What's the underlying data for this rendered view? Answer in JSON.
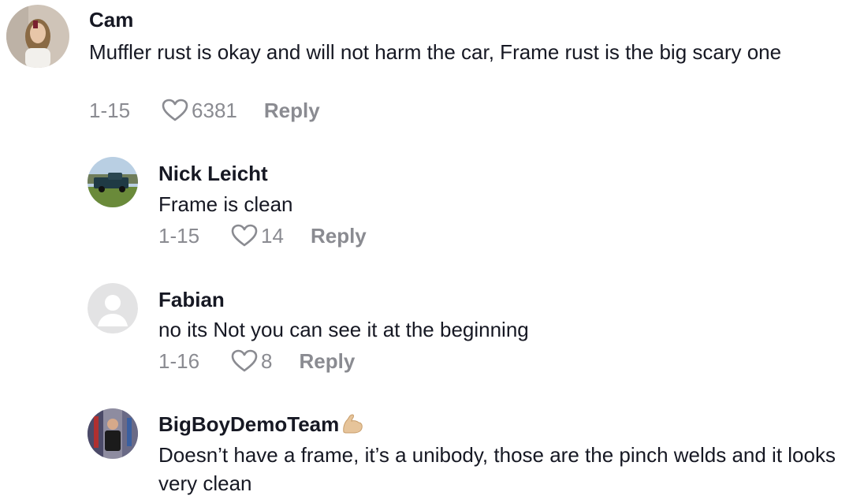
{
  "comments": [
    {
      "username": "Cam",
      "text": "Muffler rust is okay and will not harm the car, Frame rust is the big scary one",
      "date": "1-15",
      "likes": "6381",
      "reply_label": "Reply",
      "avatar": "user-photo"
    },
    {
      "username": "Nick Leicht",
      "text": "Frame is clean",
      "date": "1-15",
      "likes": "14",
      "reply_label": "Reply",
      "avatar": "truck-photo"
    },
    {
      "username": "Fabian",
      "text": "no its Not you can see it at the beginning",
      "date": "1-16",
      "likes": "8",
      "reply_label": "Reply",
      "avatar": "default-person-icon"
    },
    {
      "username": "BigBoyDemoTeam",
      "username_emoji": "flexed-biceps-emoji",
      "text": "Doesn’t have a frame, it’s a unibody, those are the pinch welds and it looks very clean",
      "avatar": "user-photo"
    }
  ],
  "icons": {
    "like": "heart-outline-icon"
  },
  "colors": {
    "primary_text": "#161823",
    "secondary_text": "#8a8b91"
  }
}
